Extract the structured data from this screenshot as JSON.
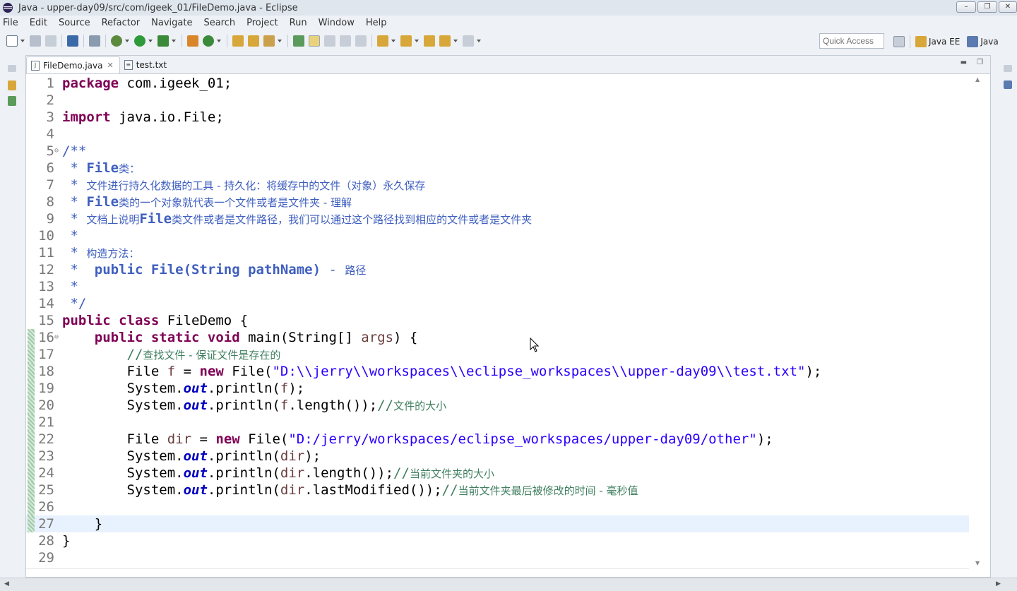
{
  "window": {
    "title": "Java - upper-day09/src/com/igeek_01/FileDemo.java - Eclipse"
  },
  "menu": [
    "File",
    "Edit",
    "Source",
    "Refactor",
    "Navigate",
    "Search",
    "Project",
    "Run",
    "Window",
    "Help"
  ],
  "toolbar": {
    "quick_access": "Quick Access"
  },
  "perspectives": [
    {
      "label": "Java EE"
    },
    {
      "label": "Java"
    }
  ],
  "tabs": [
    {
      "label": "FileDemo.java",
      "active": true
    },
    {
      "label": "test.txt",
      "active": false
    }
  ],
  "editor": {
    "current_line": 27,
    "lines": [
      {
        "n": "1",
        "html": "<span class=\"kw\">package</span> com.igeek_01;"
      },
      {
        "n": "2",
        "html": ""
      },
      {
        "n": "3",
        "html": "<span class=\"kw\">import</span> java.io.File;"
      },
      {
        "n": "4",
        "html": ""
      },
      {
        "n": "5",
        "fold": true,
        "html": "<span class=\"jd\">/**</span>"
      },
      {
        "n": "6",
        "html": "<span class=\"jd\"> * </span><span class=\"jdb\">File</span><span class=\"jd cn\">类：</span>"
      },
      {
        "n": "7",
        "html": "<span class=\"jd\"> * </span><span class=\"jd cn\">文件进行持久化数据的工具 - 持久化：将缓存中的文件（对象）永久保存</span>"
      },
      {
        "n": "8",
        "html": "<span class=\"jd\"> * </span><span class=\"jdb\">File</span><span class=\"jd cn\">类的一个对象就代表一个文件或者是文件夹 - 理解</span>"
      },
      {
        "n": "9",
        "html": "<span class=\"jd\"> * </span><span class=\"jd cn\">文档上说明</span><span class=\"jdb\">File</span><span class=\"jd cn\">类文件或者是文件路径，我们可以通过这个路径找到相应的文件或者是文件夹</span>"
      },
      {
        "n": "10",
        "html": "<span class=\"jd\"> *</span>"
      },
      {
        "n": "11",
        "html": "<span class=\"jd\"> * </span><span class=\"jd cn\">构造方法：</span>"
      },
      {
        "n": "12",
        "html": "<span class=\"jd\"> *  </span><span class=\"jdb\">public File(String pathName)</span><span class=\"jd\"> - </span><span class=\"jd cn\">路径</span>"
      },
      {
        "n": "13",
        "html": "<span class=\"jd\"> *</span>"
      },
      {
        "n": "14",
        "html": "<span class=\"jd\"> */</span>"
      },
      {
        "n": "15",
        "html": "<span class=\"kw\">public class</span> FileDemo {"
      },
      {
        "n": "16",
        "fold": true,
        "change": true,
        "html": "    <span class=\"kw\">public static void</span> main(String[] <span class=\"var\">args</span>) {"
      },
      {
        "n": "17",
        "change": true,
        "html": "        <span class=\"cm\">//</span><span class=\"cm cn\">查找文件 - 保证文件是存在的</span>"
      },
      {
        "n": "18",
        "change": true,
        "html": "        File <span class=\"var\">f</span> = <span class=\"kw\">new</span> File(<span class=\"str\">\"D:\\\\jerry\\\\workspaces\\\\eclipse_workspaces\\\\upper-day09\\\\test.txt\"</span>);"
      },
      {
        "n": "19",
        "change": true,
        "html": "        System.<span class=\"fld\">out</span>.println(<span class=\"var\">f</span>);"
      },
      {
        "n": "20",
        "change": true,
        "html": "        System.<span class=\"fld\">out</span>.println(<span class=\"var\">f</span>.length());<span class=\"cm\">//</span><span class=\"cm cn\">文件的大小</span>"
      },
      {
        "n": "21",
        "change": true,
        "html": ""
      },
      {
        "n": "22",
        "change": true,
        "html": "        File <span class=\"var\">dir</span> = <span class=\"kw\">new</span> File(<span class=\"str\">\"D:/jerry/workspaces/eclipse_workspaces/upper-day09/other\"</span>);"
      },
      {
        "n": "23",
        "change": true,
        "html": "        System.<span class=\"fld\">out</span>.println(<span class=\"var\">dir</span>);"
      },
      {
        "n": "24",
        "change": true,
        "html": "        System.<span class=\"fld\">out</span>.println(<span class=\"var\">dir</span>.length());<span class=\"cm\">//</span><span class=\"cm cn\">当前文件夹的大小</span>"
      },
      {
        "n": "25",
        "change": true,
        "html": "        System.<span class=\"fld\">out</span>.println(<span class=\"var\">dir</span>.lastModified());<span class=\"cm\">//</span><span class=\"cm cn\">当前文件夹最后被修改的时间 - 毫秒值</span>"
      },
      {
        "n": "26",
        "change": true,
        "html": ""
      },
      {
        "n": "27",
        "change": true,
        "html": "    }"
      },
      {
        "n": "28",
        "html": "}"
      },
      {
        "n": "29",
        "html": ""
      }
    ]
  },
  "colors": {
    "keyword": "#7f0055",
    "javadoc": "#3f5fbf",
    "comment": "#3f7f5f",
    "string": "#2a00ff",
    "field": "#0000c0",
    "current_line": "#e8f2fe"
  }
}
